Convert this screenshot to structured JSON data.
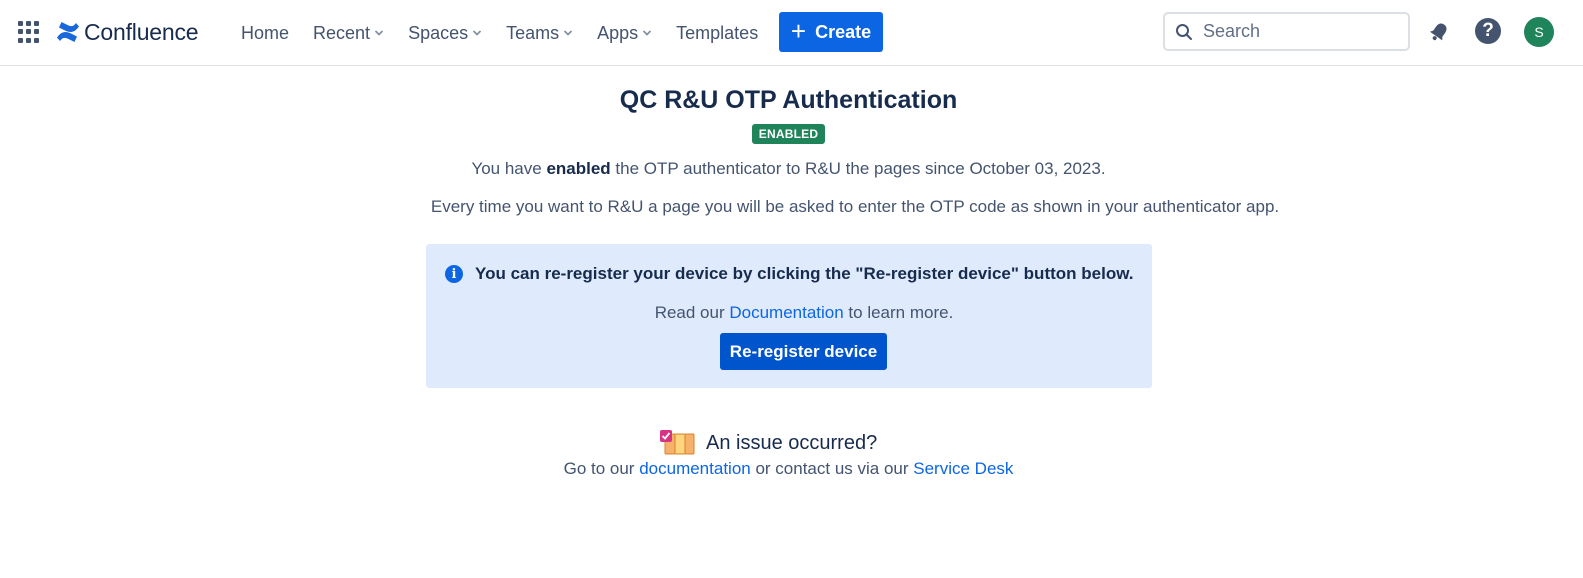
{
  "nav": {
    "app_name": "Confluence",
    "items": [
      {
        "label": "Home",
        "dropdown": false
      },
      {
        "label": "Recent",
        "dropdown": true
      },
      {
        "label": "Spaces",
        "dropdown": true
      },
      {
        "label": "Teams",
        "dropdown": true
      },
      {
        "label": "Apps",
        "dropdown": true
      },
      {
        "label": "Templates",
        "dropdown": false
      }
    ],
    "create_label": "Create",
    "search_placeholder": "Search",
    "avatar_initial": "S",
    "help_glyph": "?"
  },
  "page": {
    "title": "QC R&U OTP Authentication",
    "status_badge": "ENABLED",
    "line1_prefix": "You have ",
    "line1_bold": "enabled",
    "line1_suffix": " the OTP authenticator to R&U the pages since October 03, 2023.",
    "line2": "Every time you want to R&U a page you will be asked to enter the OTP code as shown in your authenticator app."
  },
  "info_panel": {
    "heading": "You can re-register your device by clicking the \"Re-register device\" button below.",
    "read_prefix": "Read our ",
    "read_link": "Documentation",
    "read_suffix": " to learn more.",
    "button_label": "Re-register device"
  },
  "issue": {
    "title": "An issue occurred?",
    "prefix": "Go to our ",
    "doc_link": "documentation",
    "middle": " or contact us via our ",
    "desk_link": "Service Desk"
  },
  "colors": {
    "brand_blue": "#0c66e4",
    "button_blue": "#0055cc",
    "badge_green": "#1f845a",
    "info_bg": "#dfeafd",
    "text_dark": "#172b4d",
    "text_subtle": "#44546f"
  },
  "icons": [
    "app-switcher-icon",
    "confluence-logo-icon",
    "chevron-down-icon",
    "plus-icon",
    "search-icon",
    "notification-bell-icon",
    "help-icon",
    "info-icon",
    "books-checklist-icon"
  ]
}
